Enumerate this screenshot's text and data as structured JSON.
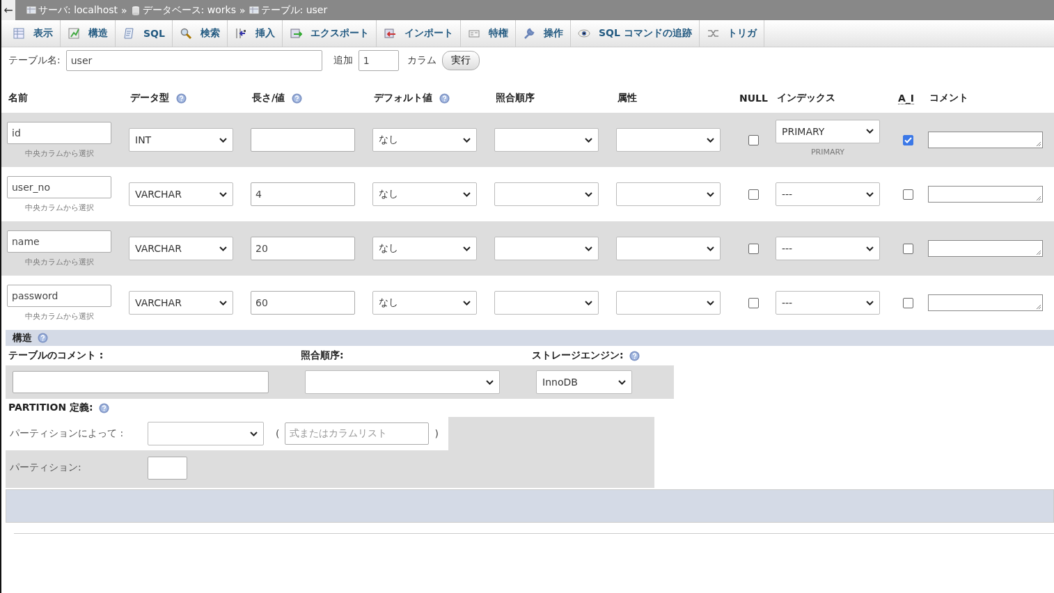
{
  "back": "←",
  "breadcrumb": [
    {
      "label": "サーバ: localhost",
      "separator": "»"
    },
    {
      "label": "データベース: works",
      "separator": "»"
    },
    {
      "label": "テーブル: user"
    }
  ],
  "tabs": [
    {
      "label": "表示"
    },
    {
      "label": "構造"
    },
    {
      "label": "SQL"
    },
    {
      "label": "検索"
    },
    {
      "label": "挿入"
    },
    {
      "label": "エクスポート"
    },
    {
      "label": "インポート"
    },
    {
      "label": "特権"
    },
    {
      "label": "操作"
    },
    {
      "label": "SQL コマンドの追跡"
    },
    {
      "label": "トリガ"
    }
  ],
  "table_name": {
    "label": "テーブル名:",
    "value": "user",
    "add_label": "追加",
    "add_value": "1",
    "columns_label": "カラム",
    "go_button": "実行"
  },
  "headers": [
    {
      "label": "名前"
    },
    {
      "label": "データ型",
      "help": true
    },
    {
      "label": "長さ/値",
      "help": true
    },
    {
      "label": "デフォルト値",
      "help": true
    },
    {
      "label": "照合順序"
    },
    {
      "label": "属性"
    },
    {
      "label": "NULL"
    },
    {
      "label": "インデックス"
    },
    {
      "label": "A_I",
      "abbreviation": true
    },
    {
      "label": "コメント"
    }
  ],
  "rows": [
    {
      "name": "id",
      "central_link": "中央カラムから選択",
      "type": "INT",
      "default": "なし",
      "null": false,
      "index": "PRIMARY",
      "index_caption": "PRIMARY",
      "ai": true
    },
    {
      "name": "user_no",
      "central_link": "中央カラムから選択",
      "type": "VARCHAR",
      "length": "4",
      "default": "なし",
      "null": false,
      "index": "---",
      "ai": false
    },
    {
      "name": "name",
      "central_link": "中央カラムから選択",
      "type": "VARCHAR",
      "length": "20",
      "default": "なし",
      "null": false,
      "index": "---",
      "ai": false
    },
    {
      "name": "password",
      "central_link": "中央カラムから選択",
      "type": "VARCHAR",
      "length": "60",
      "default": "なし",
      "null": false,
      "index": "---",
      "ai": false
    }
  ],
  "structure": {
    "title": "構造",
    "table_comment_label": "テーブルのコメント :",
    "collation_label": "照合順序:",
    "engine_label": "ストレージエンジン:",
    "engine": "InnoDB"
  },
  "partition": {
    "title": "PARTITION 定義:",
    "by_label": "パーティションによって :",
    "open": "(",
    "placeholder": "式またはカラムリスト",
    "close": ")",
    "partitions_label": "パーティション:"
  }
}
